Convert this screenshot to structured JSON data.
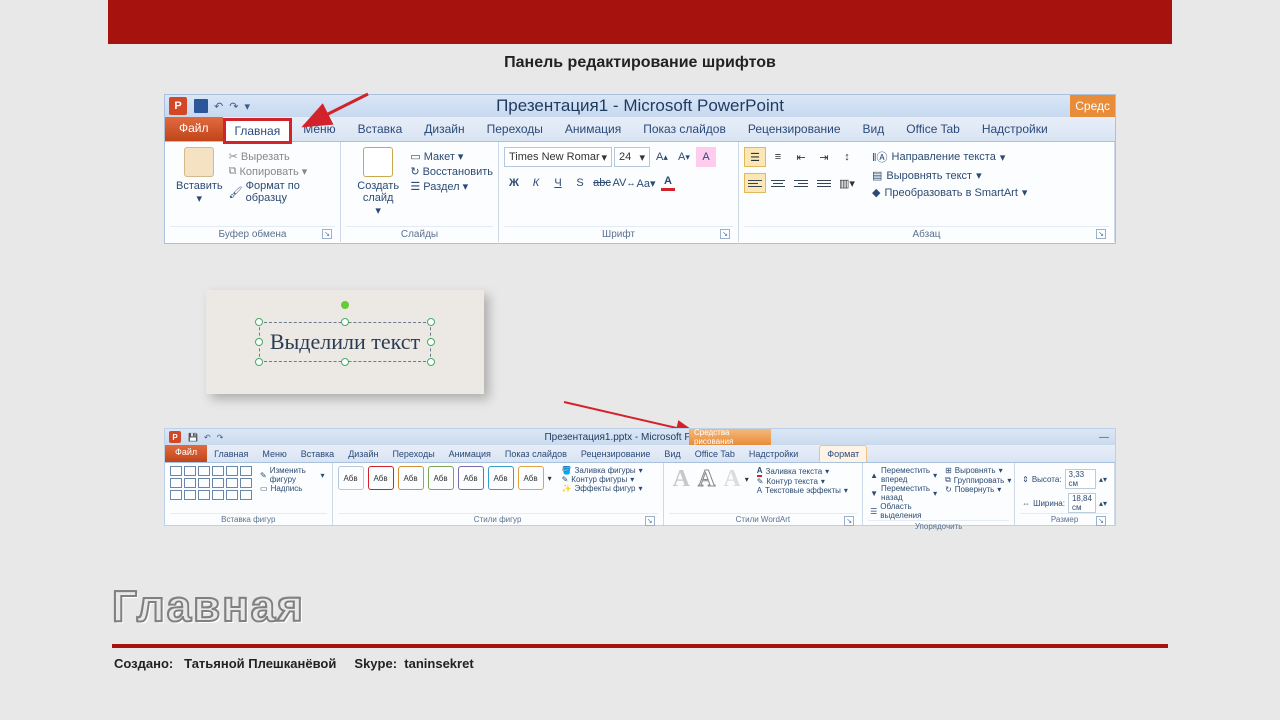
{
  "title": "Панель редактирование шрифтов",
  "shot1": {
    "window_title": "Презентация1 - Microsoft PowerPoint",
    "tool_tab": "Средс",
    "tabs": {
      "file": "Файл",
      "items": [
        "Главная",
        "Меню",
        "Вставка",
        "Дизайн",
        "Переходы",
        "Анимация",
        "Показ слайдов",
        "Рецензирование",
        "Вид",
        "Office Tab",
        "Надстройки"
      ]
    },
    "clipboard": {
      "paste": "Вставить",
      "cut": "Вырезать",
      "copy": "Копировать",
      "format_painter": "Формат по образцу",
      "label": "Буфер обмена"
    },
    "slides": {
      "new_slide": "Создать слайд",
      "layout": "Макет",
      "reset": "Восстановить",
      "section": "Раздел",
      "label": "Слайды"
    },
    "font": {
      "name": "Times New Romar",
      "size": "24",
      "label": "Шрифт"
    },
    "paragraph": {
      "text_direction": "Направление текста",
      "align_text": "Выровнять текст",
      "convert_smartart": "Преобразовать в SmartArt",
      "label": "Абзац"
    }
  },
  "selected_text": "Выделили текст",
  "shot2": {
    "window_title": "Презентация1.pptx - Microsoft PowerPoint",
    "tool_tab": "Средства рисования",
    "tabs": {
      "file": "Файл",
      "items": [
        "Главная",
        "Меню",
        "Вставка",
        "Дизайн",
        "Переходы",
        "Анимация",
        "Показ слайдов",
        "Рецензирование",
        "Вид",
        "Office Tab",
        "Надстройки"
      ],
      "format": "Формат"
    },
    "insert_shapes": {
      "edit_shape": "Изменить фигуру",
      "text_box": "Надпись",
      "label": "Вставка фигур"
    },
    "shape_styles": {
      "sample": "Абв",
      "fill": "Заливка фигуры",
      "outline": "Контур фигуры",
      "effects": "Эффекты фигур",
      "label": "Стили фигур"
    },
    "wordart": {
      "text_fill": "Заливка текста",
      "text_outline": "Контур текста",
      "text_effects": "Текстовые эффекты",
      "label": "Стили WordArt"
    },
    "arrange": {
      "bring_forward": "Переместить вперед",
      "send_backward": "Переместить назад",
      "selection_pane": "Область выделения",
      "align": "Выровнять",
      "group": "Группировать",
      "rotate": "Повернуть",
      "label": "Упорядочить"
    },
    "size": {
      "height_label": "Высота:",
      "height": "3,33 см",
      "width_label": "Ширина:",
      "width": "18,84 см",
      "label": "Размер"
    }
  },
  "heading": "Главная",
  "footer": {
    "created_label": "Создано:",
    "author": "Татьяной Плешканёвой",
    "skype_label": "Skype:",
    "skype": "taninsekret"
  }
}
